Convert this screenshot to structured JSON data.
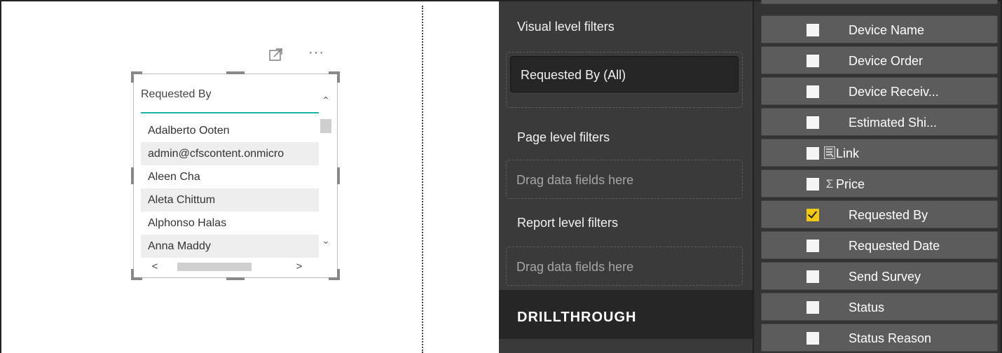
{
  "slicer": {
    "header": "Requested By",
    "items": [
      "Adalberto Ooten",
      "admin@cfscontent.onmicro",
      "Aleen Cha",
      "Aleta Chittum",
      "Alphonso Halas",
      "Anna Maddy"
    ]
  },
  "visual_toolbar": {
    "more_label": "···"
  },
  "filters_pane": {
    "visual_level_title": "Visual level filters",
    "visual_filter_pill": "Requested By  (All)",
    "page_level_title": "Page level filters",
    "page_drop_text": "Drag data fields here",
    "report_level_title": "Report level filters",
    "report_drop_text": "Drag data fields here",
    "drillthrough_title": "DRILLTHROUGH"
  },
  "fields_pane": {
    "fields": [
      {
        "label": "Device Name",
        "checked": false,
        "icon": ""
      },
      {
        "label": "Device Order",
        "checked": false,
        "icon": ""
      },
      {
        "label": "Device Receiv...",
        "checked": false,
        "icon": ""
      },
      {
        "label": "Estimated Shi...",
        "checked": false,
        "icon": ""
      },
      {
        "label": "Link",
        "checked": false,
        "icon": "link-icon"
      },
      {
        "label": "Price",
        "checked": false,
        "icon": "sigma-icon"
      },
      {
        "label": "Requested By",
        "checked": true,
        "icon": ""
      },
      {
        "label": "Requested Date",
        "checked": false,
        "icon": ""
      },
      {
        "label": "Send Survey",
        "checked": false,
        "icon": ""
      },
      {
        "label": "Status",
        "checked": false,
        "icon": ""
      },
      {
        "label": "Status Reason",
        "checked": false,
        "icon": ""
      }
    ]
  },
  "colors": {
    "accent_teal": "#1ab5a6",
    "checkbox_checked": "#f2c811",
    "filters_bg": "#3a3a3a",
    "fields_bg": "#333333",
    "field_row_bg": "#5c5c5c"
  }
}
